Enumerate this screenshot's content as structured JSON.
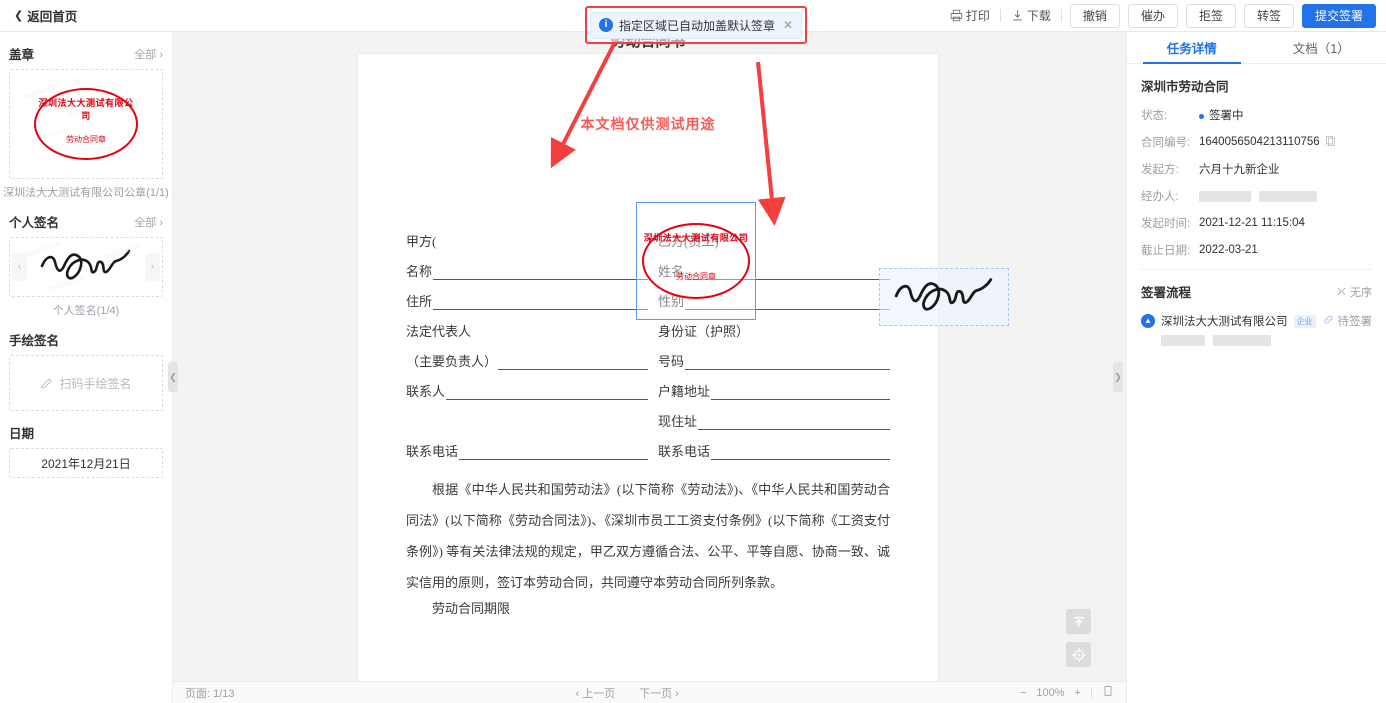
{
  "topbar": {
    "back_label": "返回首页",
    "print_label": "打印",
    "download_label": "下载",
    "buttons": [
      {
        "label": "撤销",
        "primary": false
      },
      {
        "label": "催办",
        "primary": false
      },
      {
        "label": "拒签",
        "primary": false
      },
      {
        "label": "转签",
        "primary": false
      },
      {
        "label": "提交签署",
        "primary": true
      }
    ]
  },
  "notification": {
    "text": "指定区域已自动加盖默认签章",
    "close": "✕",
    "info_glyph": "i",
    "highlight_color": "#f53f3f"
  },
  "sidebar": {
    "seal_section": {
      "title": "盖章",
      "all_label": "全部",
      "caption": "深圳法大大测试有限公司公章(1/1)"
    },
    "seal": {
      "arc_text": "深圳法大大测试有限公司",
      "mid_text": "劳动合同章",
      "color": "#e60012"
    },
    "signature_section": {
      "title": "个人签名",
      "all_label": "全部",
      "caption": "个人签名(1/4)",
      "prev": "‹",
      "next": "›"
    },
    "handdraw_section": {
      "title": "手绘签名",
      "action_label": "扫码手绘签名"
    },
    "date_section": {
      "title": "日期",
      "value": "2021年12月21日"
    },
    "watermark": "fadada.com"
  },
  "document": {
    "title": "劳动合同书",
    "watermark_top": "本文档仅供测试用途",
    "watermark_second": "本文档仅供测试用途",
    "party_a_header": "甲方(",
    "party_b_header": "乙方(员工)",
    "left_fields": [
      {
        "label": "名称",
        "line": true
      },
      {
        "label": "住所",
        "line": true
      },
      {
        "label": "法定代表人",
        "line": false
      },
      {
        "label": "（主要负责人）",
        "line": true
      },
      {
        "label": "联系人",
        "line": true
      },
      {
        "label": "",
        "line": false
      },
      {
        "label": "联系电话",
        "line": true
      }
    ],
    "right_fields": [
      {
        "label": "姓名",
        "line": true
      },
      {
        "label": "性别",
        "line": true
      },
      {
        "label": "身份证（护照）",
        "line": false
      },
      {
        "label": "号码",
        "line": true
      },
      {
        "label": "户籍地址",
        "line": true
      },
      {
        "label": "现住址",
        "line": true
      },
      {
        "label": "联系电话",
        "line": true
      }
    ],
    "paragraph": "根据《中华人民共和国劳动法》(以下简称《劳动法》)、《中华人民共和国劳动合同法》(以下简称《劳动合同法》)、《深圳市员工工资支付条例》(以下简称《工资支付条例》) 等有关法律法规的规定，甲乙双方遵循合法、公平、平等自愿、协商一致、诚实信用的原则，签订本劳动合同，共同遵守本劳动合同所列条款。",
    "next_heading": "劳动合同期限"
  },
  "bottombar": {
    "page_label": "页面: 1/13",
    "prev_page": "‹ 上一页",
    "next_page": "下一页 ›",
    "zoom_out": "−",
    "zoom_level": "100%",
    "zoom_in": "+",
    "fit_icon": "fit-page-icon"
  },
  "rightpanel": {
    "tabs": [
      {
        "label": "任务详情",
        "active": true
      },
      {
        "label": "文档（1）",
        "active": false
      }
    ],
    "contract_title": "深圳市劳动合同",
    "fields": [
      {
        "key": "状态:",
        "value": "签署中",
        "type": "status"
      },
      {
        "key": "合同编号:",
        "value": "1640056504213110756",
        "type": "copy"
      },
      {
        "key": "发起方:",
        "value": "六月十九新企业",
        "type": "text"
      },
      {
        "key": "经办人:",
        "value": "",
        "type": "blurred"
      },
      {
        "key": "发起时间:",
        "value": "2021-12-21 11:15:04",
        "type": "text"
      },
      {
        "key": "截止日期:",
        "value": "2022-03-21",
        "type": "text"
      }
    ],
    "flow": {
      "title": "签署流程",
      "order_label": "无序",
      "items": [
        {
          "name": "深圳法大大测试有限公司",
          "tag": "企业",
          "status": "待签署"
        }
      ]
    }
  }
}
